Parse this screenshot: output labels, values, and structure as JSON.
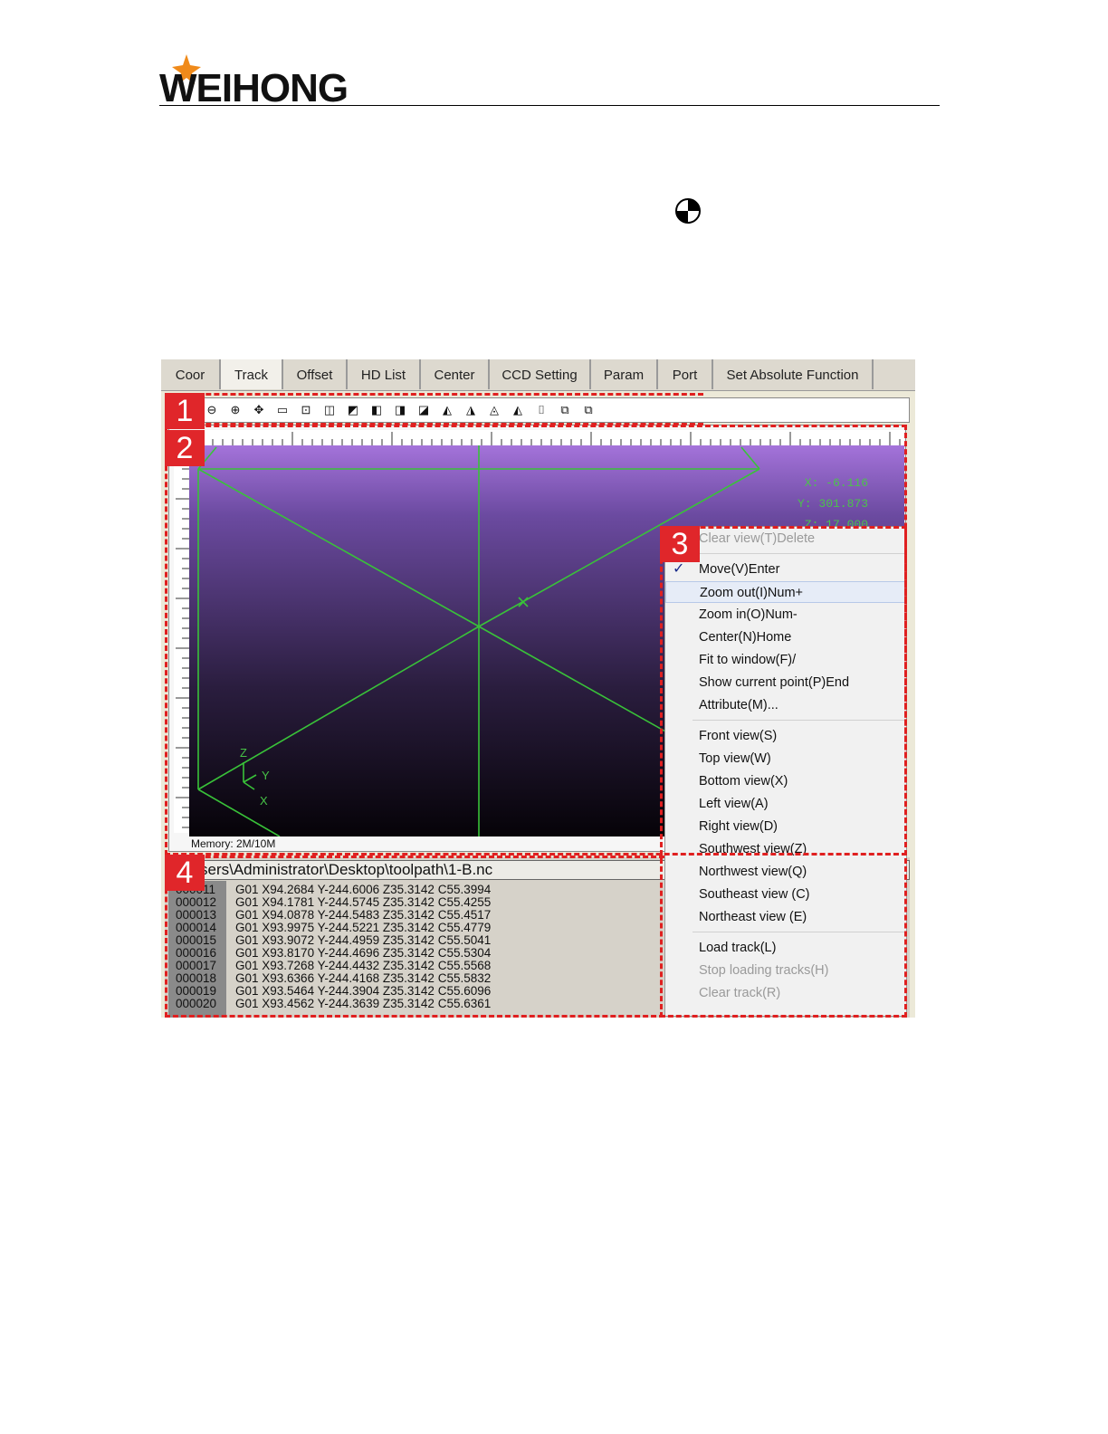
{
  "brand": {
    "name": "WEIHONG",
    "text_color": "#111111",
    "star_color": "#f08a1a"
  },
  "tabs": [
    "Coor",
    "Track",
    "Offset",
    "HD List",
    "Center",
    "CCD Setting",
    "Param",
    "Port",
    "Set Absolute Function"
  ],
  "active_tab": "Track",
  "toolbar_icons": [
    "zoom-out-icon",
    "zoom-in-icon",
    "move-icon",
    "window-icon",
    "select-icon",
    "view-front-icon",
    "view-top-icon",
    "view-bottom-icon",
    "view-left-icon",
    "view-right-icon",
    "view-southwest-icon",
    "view-northwest-icon",
    "view-southeast-icon",
    "view-northeast-icon",
    "center-icon",
    "fit-window-icon",
    "restore-icon"
  ],
  "toolbar_glyphs": [
    "⊖",
    "⊕",
    "✥",
    "▭",
    "⊡",
    "◫",
    "◩",
    "◧",
    "◨",
    "◪",
    "◭",
    "◮",
    "◬",
    "◭",
    "⌷",
    "⧉",
    "⧉"
  ],
  "coords": {
    "x": "X:    -6.116",
    "y": "Y:   301.873",
    "z": "Z:    17.000"
  },
  "axes": {
    "z": "Z",
    "y": "Y",
    "x": "X"
  },
  "memory": "Memory: 2M/10M",
  "code": {
    "path": "sers\\Administrator\\Desktop\\toolpath\\1-B.nc",
    "lines": [
      {
        "no": "000011",
        "text": "G01 X94.2684 Y-244.6006 Z35.3142 C55.3994"
      },
      {
        "no": "000012",
        "text": "G01 X94.1781 Y-244.5745 Z35.3142 C55.4255"
      },
      {
        "no": "000013",
        "text": "G01 X94.0878 Y-244.5483 Z35.3142 C55.4517"
      },
      {
        "no": "000014",
        "text": "G01 X93.9975 Y-244.5221 Z35.3142 C55.4779"
      },
      {
        "no": "000015",
        "text": "G01 X93.9072 Y-244.4959 Z35.3142 C55.5041"
      },
      {
        "no": "000016",
        "text": "G01 X93.8170 Y-244.4696 Z35.3142 C55.5304"
      },
      {
        "no": "000017",
        "text": "G01 X93.7268 Y-244.4432 Z35.3142 C55.5568"
      },
      {
        "no": "000018",
        "text": "G01 X93.6366 Y-244.4168 Z35.3142 C55.5832"
      },
      {
        "no": "000019",
        "text": "G01 X93.5464 Y-244.3904 Z35.3142 C55.6096"
      },
      {
        "no": "000020",
        "text": "G01 X93.4562 Y-244.3639 Z35.3142 C55.6361"
      }
    ]
  },
  "menu": {
    "items": [
      {
        "label": "Clear view(T)Delete",
        "disabled": true
      },
      {
        "label": "Move(V)Enter",
        "checked": true
      },
      {
        "label": "Zoom out(I)Num+",
        "highlight": true
      },
      {
        "label": "Zoom in(O)Num-"
      },
      {
        "label": "Center(N)Home"
      },
      {
        "label": "Fit to window(F)/"
      },
      {
        "label": "Show current point(P)End"
      },
      {
        "label": "Attribute(M)..."
      },
      {
        "label": "Front view(S)"
      },
      {
        "label": "Top view(W)"
      },
      {
        "label": "Bottom view(X)"
      },
      {
        "label": "Left view(A)"
      },
      {
        "label": "Right view(D)"
      },
      {
        "label": "Southwest  view(Z)"
      },
      {
        "label": "Northwest  view(Q)"
      },
      {
        "label": "Southeast view (C)"
      },
      {
        "label": "Northeast view (E)"
      },
      {
        "label": "Load track(L)"
      },
      {
        "label": "Stop loading tracks(H)",
        "disabled": true
      },
      {
        "label": "Clear track(R)",
        "disabled": true
      }
    ]
  },
  "callouts": [
    "1",
    "2",
    "3",
    "4"
  ],
  "colors": {
    "callout": "#e0262a",
    "grid_lines": "#39c239"
  }
}
